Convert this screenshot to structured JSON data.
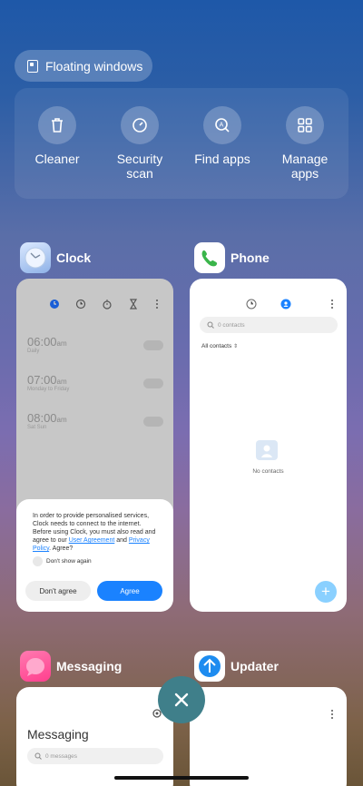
{
  "floating_windows": "Floating windows",
  "tools": [
    {
      "label": "Cleaner",
      "icon": "trash-icon"
    },
    {
      "label": "Security\nscan",
      "icon": "security-icon"
    },
    {
      "label": "Find apps",
      "icon": "find-icon"
    },
    {
      "label": "Manage\napps",
      "icon": "grid-icon"
    }
  ],
  "apps": {
    "clock": {
      "name": "Clock",
      "alarms": [
        {
          "time": "06:00",
          "ampm": "am",
          "repeat": "Daily"
        },
        {
          "time": "07:00",
          "ampm": "am",
          "repeat": "Monday to Friday"
        },
        {
          "time": "08:00",
          "ampm": "am",
          "repeat": "Sat Sun"
        }
      ],
      "dialog": {
        "text_1": "In order to provide personalised services, Clock needs to connect to the internet. Before using Clock, you must also read and agree to our ",
        "link_1": "User Agreement",
        "text_2": " and ",
        "link_2": "Privacy Policy",
        "text_3": ". Agree?",
        "checkbox": "Don't show again",
        "btn_disagree": "Don't agree",
        "btn_agree": "Agree"
      }
    },
    "phone": {
      "name": "Phone",
      "search_placeholder": "0 contacts",
      "filter": "All contacts",
      "empty": "No contacts"
    },
    "messaging": {
      "name": "Messaging",
      "title": "Messaging",
      "search_placeholder": "0 messages"
    },
    "updater": {
      "name": "Updater"
    }
  },
  "colors": {
    "accent": "#1a82ff",
    "close": "#3f7f8a"
  }
}
